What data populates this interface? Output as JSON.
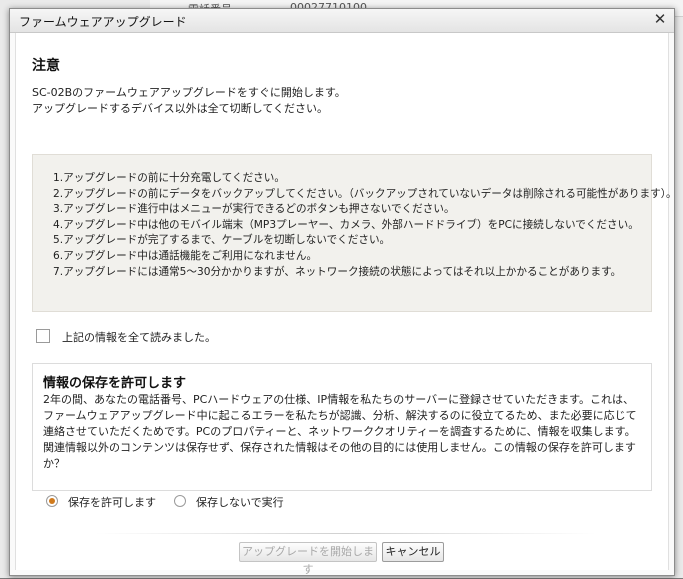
{
  "background": {
    "label": "電話番号",
    "value": "00027710100"
  },
  "dialog": {
    "title": "ファームウェアアップグレード",
    "close_glyph": "✕"
  },
  "notice": {
    "heading": "注意",
    "intro_line1": "SC-02Bのファームウェアアップグレードをすぐに開始します。",
    "intro_line2": "アップグレードするデバイス以外は全て切断してください。"
  },
  "steps": [
    "1.アップグレードの前に十分充電してください。",
    "2.アップグレードの前にデータをバックアップしてください。（バックアップされていないデータは削除される可能性があります）。",
    "3.アップグレード進行中はメニューが実行できるどのボタンも押さないでください。",
    "4.アップグレード中は他のモバイル端末（MP3プレーヤー、カメラ、外部ハードドライブ）をPCに接続しないでください。",
    "5.アップグレードが完了するまで、ケーブルを切断しないでください。",
    "6.アップグレード中は通話機能をご利用になれません。",
    "7.アップグレードには通常5～30分かかりますが、ネットワーク接続の状態によってはそれ以上かかることがあります。"
  ],
  "confirm": {
    "label": "上記の情報を全て読みました。",
    "checked": false
  },
  "privacy": {
    "heading": "情報の保存を許可します",
    "body": "2年の間、あなたの電話番号、PCハードウェアの仕様、IP情報を私たちのサーバーに登録させていただきます。これは、ファームウェアアップグレード中に起こるエラーを私たちが認識、分析、解決するのに役立てるため、また必要に応じて連絡させていただくためです。PCのプロパティーと、ネットワーククオリティーを調査するために、情報を収集します。関連情報以外のコンテンツは保存せず、保存された情報はその他の目的には使用しません。この情報の保存を許可しますか？",
    "options": [
      {
        "label": "保存を許可します",
        "selected": true
      },
      {
        "label": "保存しないで実行",
        "selected": false
      }
    ]
  },
  "buttons": {
    "start_label": "アップグレードを開始します",
    "start_enabled": false,
    "cancel_label": "キャンセル"
  },
  "colors": {
    "radio_accent": "#d07a1c",
    "steps_background": "#f2f1ed"
  }
}
